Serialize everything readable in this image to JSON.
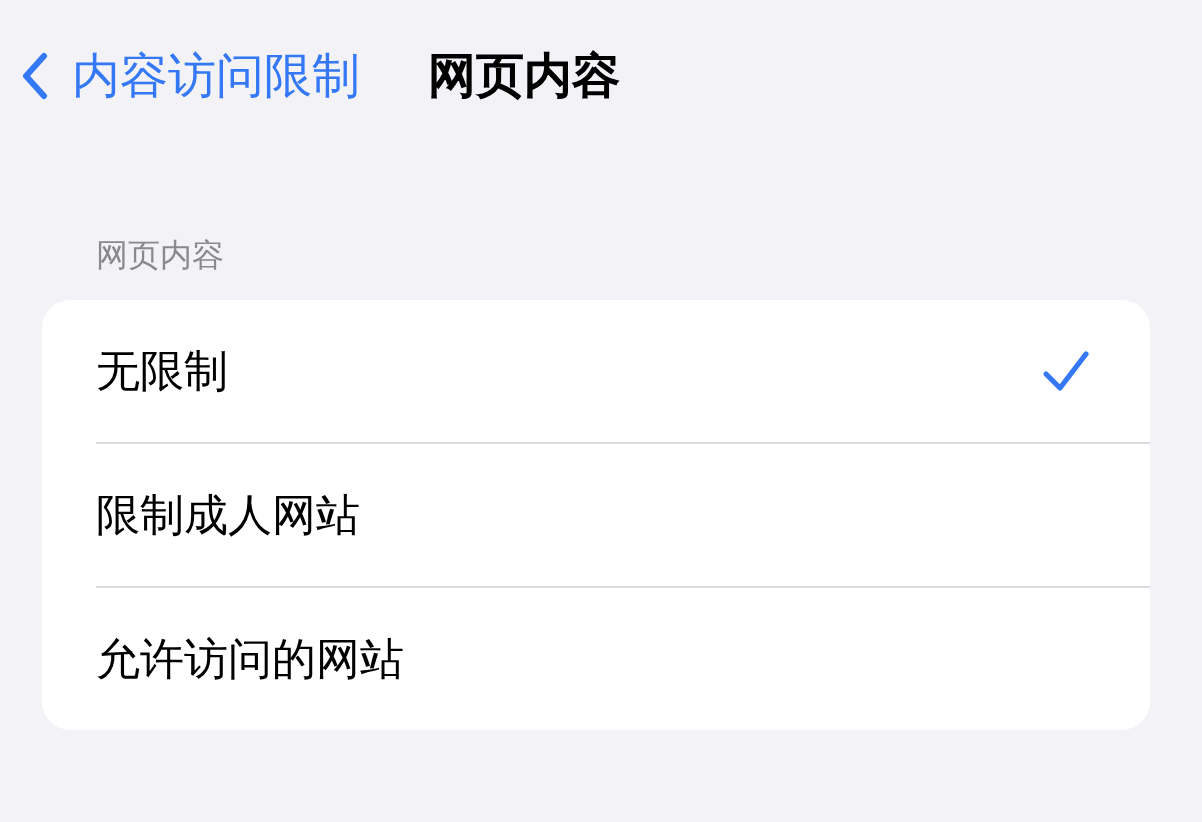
{
  "nav_bar": {
    "back_label": "内容访问限制",
    "title": "网页内容"
  },
  "section": {
    "header": "网页内容",
    "options": [
      {
        "label": "无限制",
        "selected": true
      },
      {
        "label": "限制成人网站",
        "selected": false
      },
      {
        "label": "允许访问的网站",
        "selected": false
      }
    ]
  }
}
